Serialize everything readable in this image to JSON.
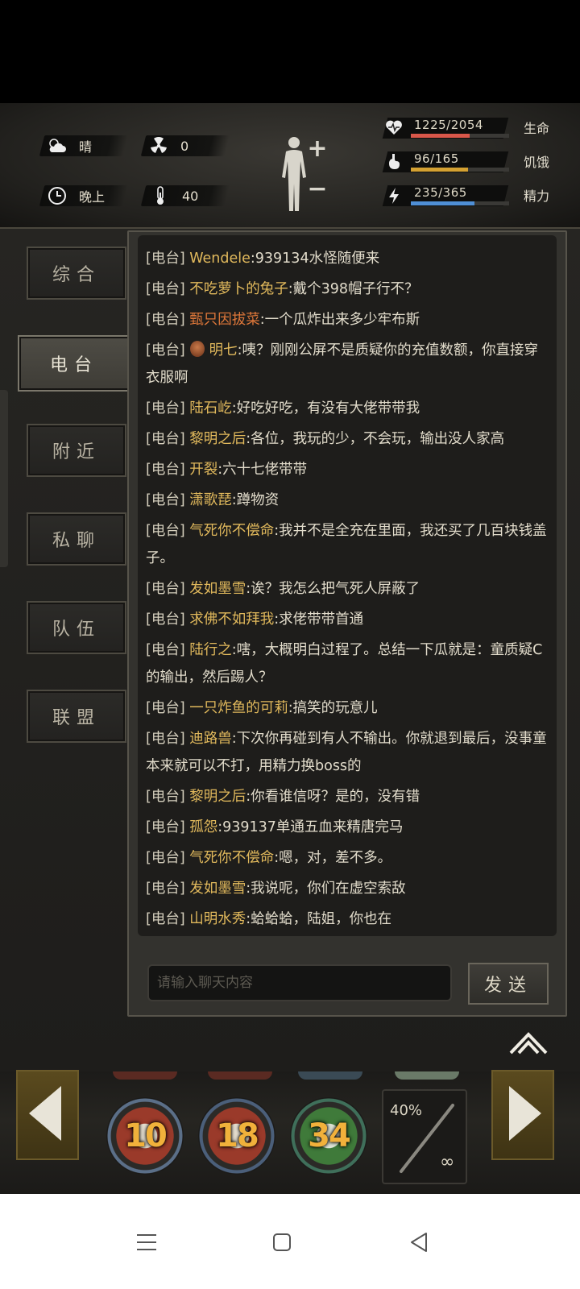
{
  "hud": {
    "weather": "晴",
    "radiation": "0",
    "time_of_day": "晚上",
    "temperature": "40",
    "stats": [
      {
        "name": "生命",
        "value": "1225/2054",
        "fraction": 0.596,
        "color": "#d9574a",
        "icon": "heart-pulse-icon"
      },
      {
        "name": "饥饿",
        "value": "96/165",
        "fraction": 0.582,
        "color": "#d4a132",
        "icon": "stomach-icon"
      },
      {
        "name": "精力",
        "value": "235/365",
        "fraction": 0.644,
        "color": "#4f8fd6",
        "icon": "energy-icon"
      }
    ]
  },
  "tabs": [
    "综合",
    "电台",
    "附近",
    "私聊",
    "队伍",
    "联盟"
  ],
  "active_tab": "电台",
  "channel_tag": "[电台]",
  "messages": [
    {
      "name": "Wendele",
      "text": ":939134水怪随便来",
      "name_color": "gold"
    },
    {
      "name": "不吃萝卜的兔子",
      "text": ":戴个398帽子行不？",
      "name_color": "gold"
    },
    {
      "name": "甄只因拔菜",
      "text": ":一个瓜炸出来多少牢布斯",
      "name_color": "red"
    },
    {
      "name": "明七",
      "text": ":咦？刚刚公屏不是质疑你的充值数额，你直接穿衣服啊",
      "name_color": "gold",
      "avatar": true
    },
    {
      "name": "陆石屹",
      "text": ":好吃好吃，有没有大佬带带我",
      "name_color": "gold"
    },
    {
      "name": "黎明之后",
      "text": ":各位，我玩的少，不会玩，输出没人家高",
      "name_color": "gold"
    },
    {
      "name": "开裂",
      "text": ":六十七佬带带",
      "name_color": "gold"
    },
    {
      "name": "潇歌琵",
      "text": ":蹲物资",
      "name_color": "gold"
    },
    {
      "name": "气死你不偿命",
      "text": ":我并不是全充在里面，我还买了几百块钱盖子。",
      "name_color": "gold"
    },
    {
      "name": "发如墨雪",
      "text": ":诶？我怎么把气死人屏蔽了",
      "name_color": "gold"
    },
    {
      "name": "求佛不如拜我",
      "text": ":求佬带带首通",
      "name_color": "gold"
    },
    {
      "name": "陆行之",
      "text": ":嗐，大概明白过程了。总结一下瓜就是：童质疑C的输出，然后踢人？",
      "name_color": "gold"
    },
    {
      "name": "一只炸鱼的可莉",
      "text": ":搞笑的玩意儿",
      "name_color": "gold"
    },
    {
      "name": "迪路兽",
      "text": ":下次你再碰到有人不输出。你就退到最后，没事童本来就可以不打，用精力换boss的",
      "name_color": "gold"
    },
    {
      "name": "黎明之后",
      "text": ":你看谁信呀？是的，没有错",
      "name_color": "gold"
    },
    {
      "name": "孤怨",
      "text": ":939137单通五血来精唐完马",
      "name_color": "gold"
    },
    {
      "name": "气死你不偿命",
      "text": ":嗯，对，差不多。",
      "name_color": "gold"
    },
    {
      "name": "发如墨雪",
      "text": ":我说呢，你们在虚空索敌",
      "name_color": "gold"
    },
    {
      "name": "山明水秀",
      "text": ":蛤蛤蛤，陆姐，你也在",
      "name_color": "gold"
    }
  ],
  "input": {
    "placeholder": "请输入聊天内容"
  },
  "send_label": "发送",
  "skills": [
    {
      "count": "10",
      "ring": "#5a6f8a"
    },
    {
      "count": "18",
      "ring": "#4b5f7a"
    },
    {
      "count": "34",
      "ring": "#3f6f5a"
    }
  ],
  "weapon": {
    "durability": "40%",
    "ammo": "∞"
  }
}
